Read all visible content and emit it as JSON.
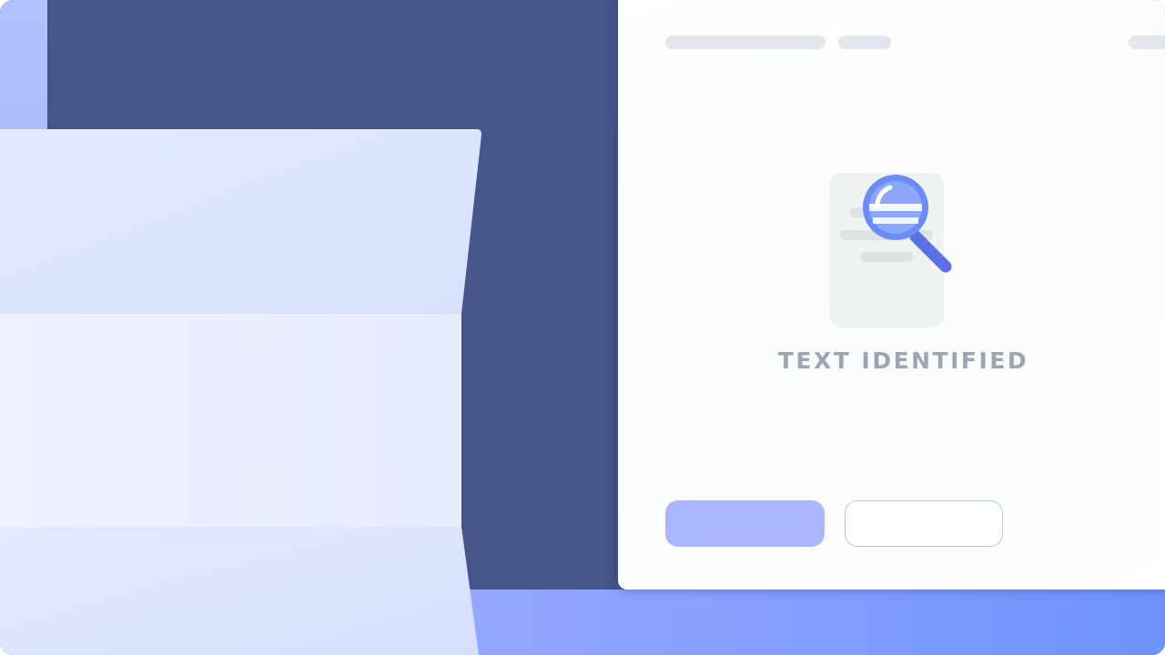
{
  "status": {
    "text": "TEXT IDENTIFIED"
  },
  "icons": {
    "document": "document-icon",
    "magnifier": "magnifying-glass-icon"
  },
  "colors": {
    "background": "#45568a",
    "accent": "#6b8cf8",
    "accent_dark": "#5b6fe6",
    "primary_button": "#a9b6fb",
    "status_text": "#9aa6b8"
  }
}
